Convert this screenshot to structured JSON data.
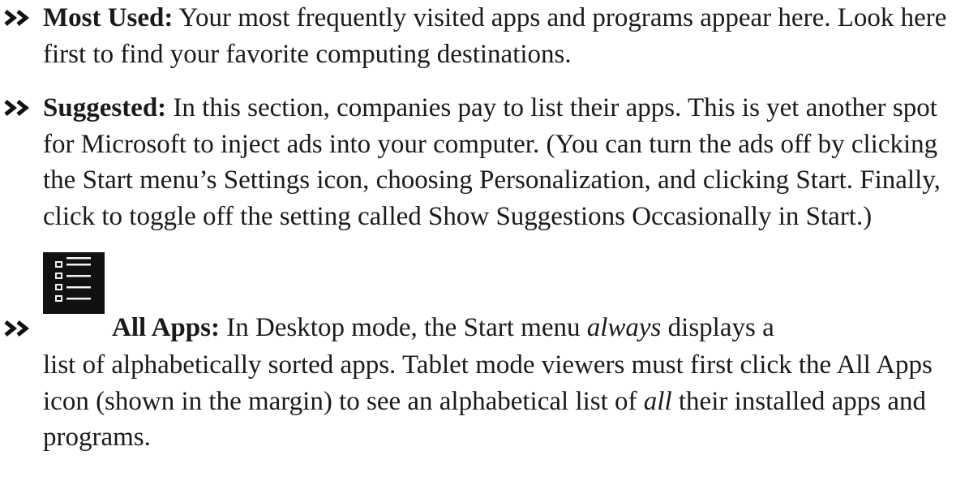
{
  "items": [
    {
      "term": "Most Used:",
      "text": " Your most frequently visited apps and programs appear here. Look here first to find your favorite computing destinations."
    },
    {
      "term": "Suggested:",
      "text": " In this section, companies pay to list their apps. This is yet another spot for Microsoft to inject ads into your computer. (You can turn the ads off by clicking the Start menu’s Settings icon, choosing Personalization, and clicking Start. Finally, click to toggle off the setting called Show Suggestions Occasionally in Start.)"
    },
    {
      "icon": "all-apps-list-icon",
      "term": "All Apps:",
      "text_a": " In Desktop mode, the Start menu ",
      "emph_a": "always",
      "text_b": " displays a list of alphabetically sorted apps. Tablet mode viewers must first click the All Apps icon (shown in the margin) to see an alphabetical list of ",
      "emph_b": "all",
      "text_c": " their installed apps and programs."
    }
  ],
  "bullet_glyph": "»"
}
